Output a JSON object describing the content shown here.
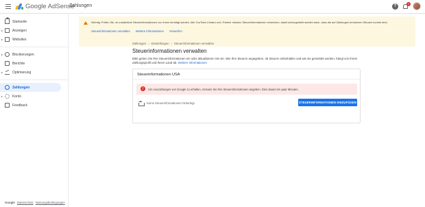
{
  "topbar": {
    "logo_text": "Google AdSense",
    "page_heading": "Zahlungen",
    "notification_count": "1"
  },
  "sidebar": {
    "items": [
      {
        "label": "Startseite",
        "icon": "home-icon"
      },
      {
        "label": "Anzeigen",
        "icon": "ads-icon"
      },
      {
        "label": "Websites",
        "icon": "websites-icon"
      },
      {
        "label": "Blockierungen",
        "icon": "block-icon"
      },
      {
        "label": "Berichte",
        "icon": "reports-icon"
      },
      {
        "label": "Optimierung",
        "icon": "optimization-icon"
      },
      {
        "label": "Zahlungen",
        "icon": "payments-icon"
      },
      {
        "label": "Konto",
        "icon": "account-gear-icon"
      },
      {
        "label": "Feedback",
        "icon": "feedback-icon"
      }
    ],
    "footer": {
      "brand": "Google",
      "privacy": "Datenschutz",
      "terms": "Nutzungsbedingungen"
    }
  },
  "alert": {
    "text": "Wichtig: Prüfen Sie, ob zusätzliche Steuerinformationen von Ihnen benötigt werden. Alle YouTube-Creator und -Partner müssen Steuerinformationen einreichen, damit sichergestellt werden kann, dass die auf Zahlungen erhobenen Steuern korrekt sind.",
    "links": [
      "Steuerinformationen verwalten",
      "Weitere Informationen",
      "Verwerfen"
    ]
  },
  "breadcrumb": [
    "Zahlungen",
    "Einstellungen",
    "Steuerinformationen verwalten"
  ],
  "main": {
    "title": "Steuerinformationen verwalten",
    "intro": "Bitte geben Sie Ihre Steuerinformationen ein oder aktualisieren Sie sie. Wie Ihre Steuern angegeben, ob Steuern einbehalten und wie sie gemeldet werden, hängt von Ihrem Zahlungsprofil und Ihrem Land ab.",
    "intro_link": "Weitere Informationen"
  },
  "card": {
    "title": "Steuerinformationen USA",
    "error": "Um Auszahlungen von Google zu erhalten, müssen Sie Ihre Steuerinformationen angeben. Dies dauert ein paar Minuten.",
    "empty_text": "Keine Steuerinformationen hinterlegt",
    "add_button": "STEUERINFORMATIONEN HINZUFÜGEN"
  },
  "colors": {
    "accent": "#1a73e8",
    "alert_bg": "#fef7e0",
    "error_bg": "#fce8e6",
    "active_nav_bg": "#e8f0fe"
  }
}
